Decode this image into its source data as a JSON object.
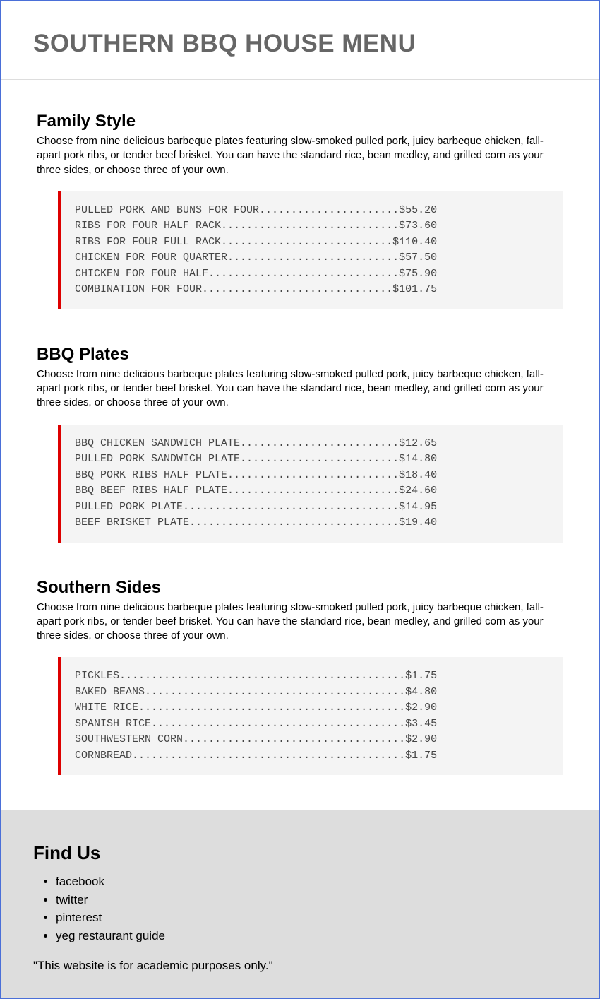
{
  "header": {
    "title": "SOUTHERN BBQ HOUSE MENU"
  },
  "sections": [
    {
      "title": "Family Style",
      "description": "Choose from nine delicious barbeque plates featuring slow-smoked pulled pork, juicy barbeque chicken, fall-apart pork ribs, or tender beef brisket. You can have the standard rice, bean medley, and grilled corn as your three sides, or choose three of your own.",
      "items": [
        {
          "name": "PULLED PORK AND BUNS FOR FOUR",
          "price": "$55.20"
        },
        {
          "name": "RIBS FOR FOUR HALF RACK",
          "price": "$73.60"
        },
        {
          "name": "RIBS FOR FOUR FULL RACK",
          "price": "$110.40"
        },
        {
          "name": "CHICKEN FOR FOUR QUARTER",
          "price": "$57.50"
        },
        {
          "name": "CHICKEN FOR FOUR HALF",
          "price": "$75.90"
        },
        {
          "name": "COMBINATION FOR FOUR",
          "price": "$101.75"
        }
      ]
    },
    {
      "title": "BBQ Plates",
      "description": "Choose from nine delicious barbeque plates featuring slow-smoked pulled pork, juicy barbeque chicken, fall-apart pork ribs, or tender beef brisket. You can have the standard rice, bean medley, and grilled corn as your three sides, or choose three of your own.",
      "items": [
        {
          "name": "BBQ CHICKEN SANDWICH PLATE",
          "price": "$12.65"
        },
        {
          "name": "PULLED PORK SANDWICH PLATE",
          "price": "$14.80"
        },
        {
          "name": "BBQ PORK RIBS HALF PLATE",
          "price": "$18.40"
        },
        {
          "name": "BBQ BEEF RIBS HALF PLATE",
          "price": "$24.60"
        },
        {
          "name": "PULLED PORK PLATE",
          "price": "$14.95"
        },
        {
          "name": "BEEF BRISKET PLATE",
          "price": "$19.40"
        }
      ]
    },
    {
      "title": "Southern Sides",
      "description": "Choose from nine delicious barbeque plates featuring slow-smoked pulled pork, juicy barbeque chicken, fall-apart pork ribs, or tender beef brisket. You can have the standard rice, bean medley, and grilled corn as your three sides, or choose three of your own.",
      "items": [
        {
          "name": "PICKLES",
          "price": "$1.75"
        },
        {
          "name": "BAKED BEANS",
          "price": "$4.80"
        },
        {
          "name": "WHITE RICE",
          "price": "$2.90"
        },
        {
          "name": "SPANISH RICE",
          "price": "$3.45"
        },
        {
          "name": "SOUTHWESTERN CORN",
          "price": "$2.90"
        },
        {
          "name": "CORNBREAD",
          "price": "$1.75"
        }
      ]
    }
  ],
  "footer": {
    "title": "Find Us",
    "links": [
      "facebook",
      "twitter",
      "pinterest",
      "yeg restaurant guide"
    ],
    "disclaimer": "\"This website is for academic purposes only.\""
  },
  "layout": {
    "line_width": 57
  }
}
